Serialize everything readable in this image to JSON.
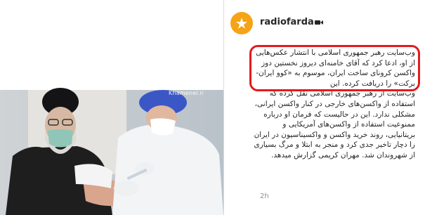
{
  "post": {
    "username": "radiofarda",
    "caption_highlight": "وب‌سایت رهبر جمهوری اسلامی با انتشار عکس‌هایی از او، ادعا کرد که آقای خامنه‌ای دیروز نخستین دوز واکسن کرونای ساخت ایران، موسوم به «کوو ایران-برکت» را دریافت کرده. این",
    "caption_body": "وب‌سایت از رهبر جمهوری اسلامی نقل کرده که استفاده از واکسن‌های خارجی در کنار واکسن ایرانی، مشکلی ندارد. این در حالیست که فرمان او درباره ممنوعیت استفاده از واکسن‌های آمریکایی و بریتانیایی، روند خرید واکسن و واکسیناسیون در ایران را دچار تاخیر جدی کرد و منجر به ابتلا و مرگ بسیاری از شهروندان شد. مهران کریمی گزارش میدهد.",
    "timestamp": "2h"
  },
  "photo": {
    "watermark": "Khamenei.ir"
  },
  "colors": {
    "highlight": "#e21b1b",
    "avatar": "#f6a315"
  },
  "icons": [
    "radiofarda-logo-icon",
    "video-camera-icon"
  ]
}
